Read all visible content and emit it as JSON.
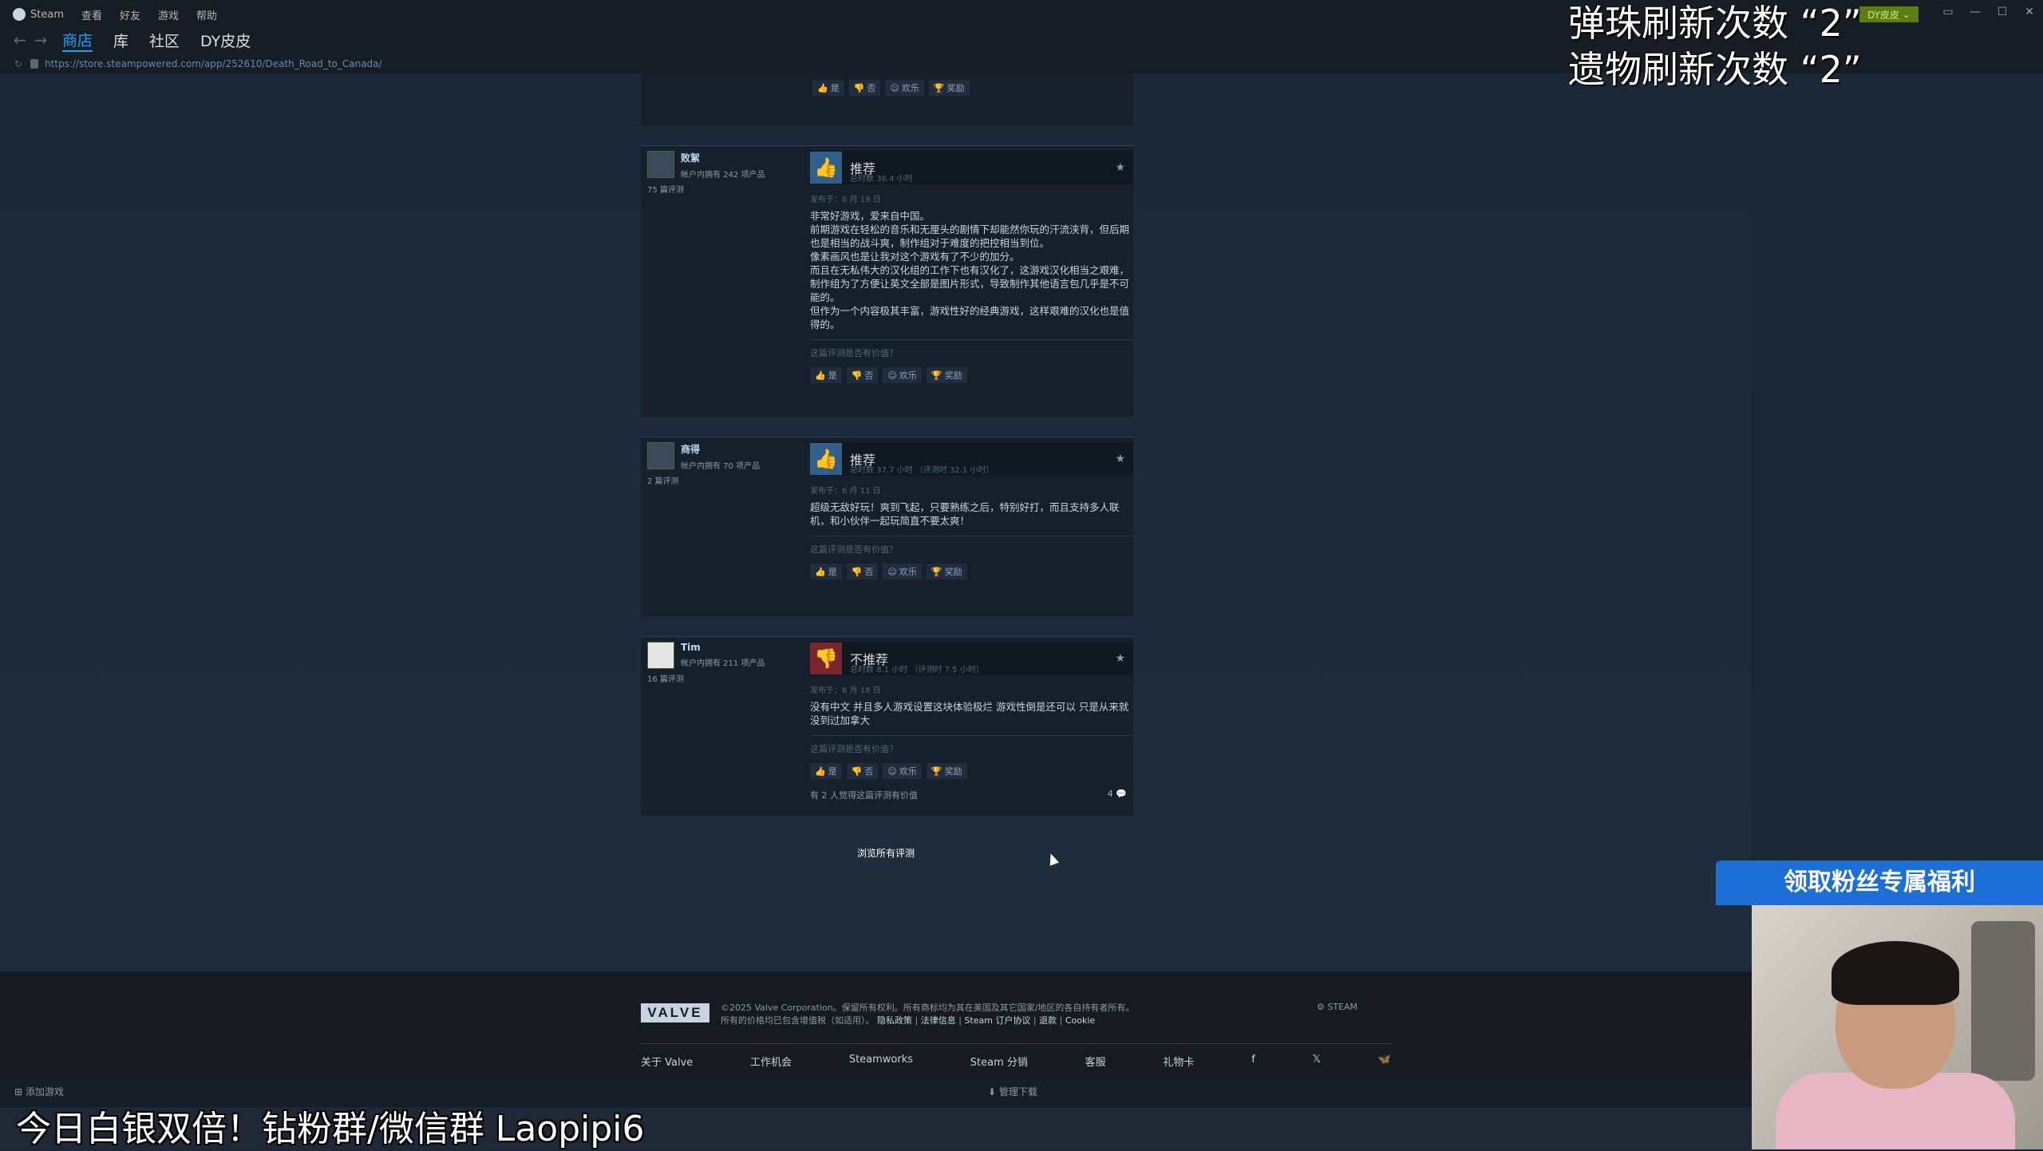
{
  "titlebar": {
    "app": "Steam",
    "menu": [
      "查看",
      "好友",
      "游戏",
      "帮助"
    ],
    "user": "DY皮皮"
  },
  "nav": {
    "tabs": [
      "商店",
      "库",
      "社区",
      "DY皮皮"
    ],
    "active_tab": "商店",
    "url": "https://store.steampowered.com/app/252610/Death_Road_to_Canada/"
  },
  "vote_labels": {
    "yes": "是",
    "no": "否",
    "funny": "欢乐",
    "award": "奖励"
  },
  "reviews": [
    {
      "author": "败絮",
      "owned": "帐户内拥有 242 项产品",
      "count": "75 篇评测",
      "recommend": "推荐",
      "hours": "总时数 36.4 小时",
      "posted": "发布于：6 月 19 日",
      "text": [
        "非常好游戏，爱来自中国。",
        "前期游戏在轻松的音乐和无厘头的剧情下却能然你玩的汗流浃背，但后期也是相当的战斗爽，制作组对于难度的把控相当到位。",
        "像素画风也是让我对这个游戏有了不少的加分。",
        "而且在无私伟大的汉化组的工作下也有汉化了，这游戏汉化相当之艰难，制作组为了方便让英文全部是图片形式，导致制作其他语言包几乎是不可能的。",
        "但作为一个内容极其丰富，游戏性好的经典游戏，这样艰难的汉化也是值得的。"
      ],
      "helpful_q": "这篇评测是否有价值？"
    },
    {
      "author": "商得",
      "owned": "帐户内拥有 70 项产品",
      "count": "2 篇评测",
      "recommend": "推荐",
      "hours": "总时数 37.7 小时 （评测时 32.1 小时）",
      "posted": "发布于：6 月 11 日",
      "text": [
        "超级无敌好玩！爽到飞起，只要熟练之后，特别好打，而且支持多人联机，和小伙伴一起玩简直不要太爽！"
      ],
      "helpful_q": "这篇评测是否有价值？"
    },
    {
      "author": "Tim",
      "owned": "帐户内拥有 211 项产品",
      "count": "16 篇评测",
      "recommend": "不推荐",
      "hours": "总时数 8.1 小时 （评测时 7.5 小时）",
      "posted": "发布于：6 月 18 日",
      "text": [
        "没有中文 并且多人游戏设置这块体验极烂 游戏性倒是还可以 只是从来就没到过加拿大"
      ],
      "helpful_q": "这篇评测是否有价值？",
      "found_helpful": "有 2 人觉得这篇评测有价值",
      "comments": "4"
    }
  ],
  "browse_all": "浏览所有评测",
  "footer": {
    "valve": "VALVE",
    "legal1": "©2025 Valve Corporation。保留所有权利。所有商标均为其在美国及其它国家/地区的各自持有者所有。",
    "legal2": "所有的价格均已包含增值税（如适用）。",
    "legal_links": [
      "隐私政策",
      "法律信息",
      "Steam 订户协议",
      "退款",
      "Cookie"
    ],
    "steam": "STEAM",
    "links": [
      "关于 Valve",
      "工作机会",
      "Steamworks",
      "Steam 分销",
      "客服",
      "礼物卡",
      "f",
      "𝕏",
      "🦋"
    ]
  },
  "bottom": {
    "add_game": "添加游戏",
    "manage": "管理下载"
  },
  "overlays": {
    "line1": "弹珠刷新次数 “2”",
    "line2": "遗物刷新次数 “2”",
    "fan_banner": "领取粉丝专属福利",
    "bottom_text": "今日白银双倍！钻粉群/微信群 Laopipi6"
  }
}
